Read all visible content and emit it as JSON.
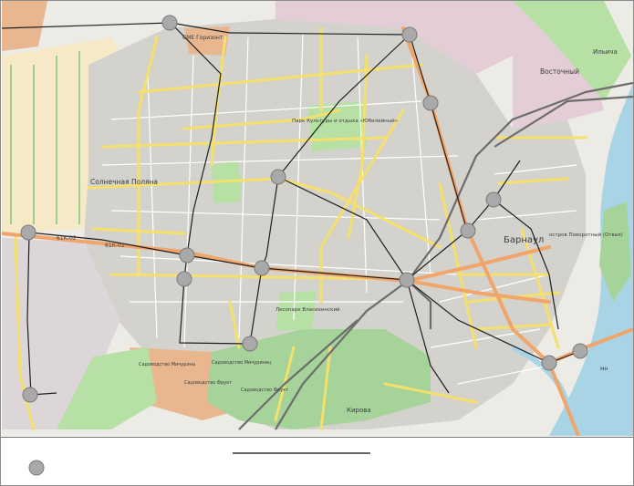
{
  "map": {
    "labels": {
      "smt": "СМЕ Горизонт",
      "solnechnaya_polyana": "Солнечная Поляна",
      "park": "Парк Культуры и отдыха «Юбилейный»",
      "barnaul": "Барнаул",
      "vostochny": "Восточный",
      "ilyich": "Ильича",
      "island": "остров Поворотный (Отвал)",
      "road_code_1": "61К-02",
      "road_code_2": "61К-02",
      "kirova": "Кирова",
      "sadovod_1": "Садоводство Мичурина",
      "sadovod_2": "Садоводство Мичуринец",
      "sadovod_3": "Садоводство Фрукт",
      "sadovod_4": "Садоводство Фрукт",
      "lesopark": "Лесопарк Власихинский",
      "edge_label": "мн"
    },
    "colors": {
      "land": "#ecebe6",
      "urban": "#d4d2cd",
      "green": "#b6e0a4",
      "wood": "#a6d39a",
      "water": "#a8d4e6",
      "farmland": "#f6e9c8",
      "allotments": "#e8b790",
      "industrial": "#e3cdd6",
      "road_yellow": "#f4e06a",
      "road_orange": "#f0a56b",
      "tram": "#1f1f1f",
      "marker_fill": "#a9a9a9",
      "marker_stroke": "#7a7a7a"
    },
    "marker_icon": "gray-circle-marker"
  },
  "legend": {
    "swatch_icon": "gray-circle-marker",
    "label": ""
  }
}
